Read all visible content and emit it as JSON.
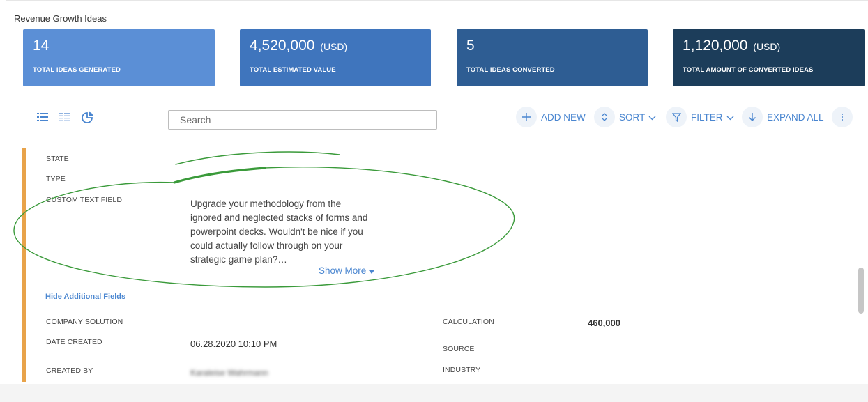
{
  "page": {
    "title": "Revenue Growth Ideas"
  },
  "cards": [
    {
      "value": "14",
      "unit": "",
      "caption": "TOTAL IDEAS GENERATED",
      "color": "#5b8fd6"
    },
    {
      "value": "4,520,000",
      "unit": "(USD)",
      "caption": "TOTAL ESTIMATED VALUE",
      "color": "#3f75bd"
    },
    {
      "value": "5",
      "unit": "",
      "caption": "TOTAL IDEAS CONVERTED",
      "color": "#2e5d93"
    },
    {
      "value": "1,120,000",
      "unit": "(USD)",
      "caption": "TOTAL AMOUNT OF CONVERTED IDEAS",
      "color": "#1c3d5a"
    }
  ],
  "toolbar": {
    "view_icons": [
      "list-view-icon",
      "detail-list-view-icon",
      "chart-view-icon"
    ],
    "search_placeholder": "Search",
    "add_new": "ADD NEW",
    "sort": "SORT",
    "filter": "FILTER",
    "expand_all": "EXPAND ALL"
  },
  "fields": {
    "state_label": "STATE",
    "type_label": "TYPE",
    "custom_text_label": "CUSTOM TEXT FIELD",
    "custom_text_value": "Upgrade your methodology from the ignored and neglected stacks of forms and powerpoint decks. Wouldn't be nice if you could actually follow through on your strategic game plan?…",
    "show_more": "Show More",
    "hide_additional": "Hide Additional Fields",
    "company_solution_label": "COMPANY SOLUTION",
    "date_created_label": "DATE CREATED",
    "date_created_value": "06.28.2020 10:10 PM",
    "created_by_label": "CREATED BY",
    "created_by_value": "Karaleise Wahrmann",
    "calculation_label": "CALCULATION",
    "calculation_value": "460,000",
    "source_label": "SOURCE",
    "industry_label": "INDUSTRY"
  },
  "colors": {
    "accent": "#4a86d0",
    "record_bar": "#e8a34a",
    "annotation": "#3a9a3a"
  }
}
